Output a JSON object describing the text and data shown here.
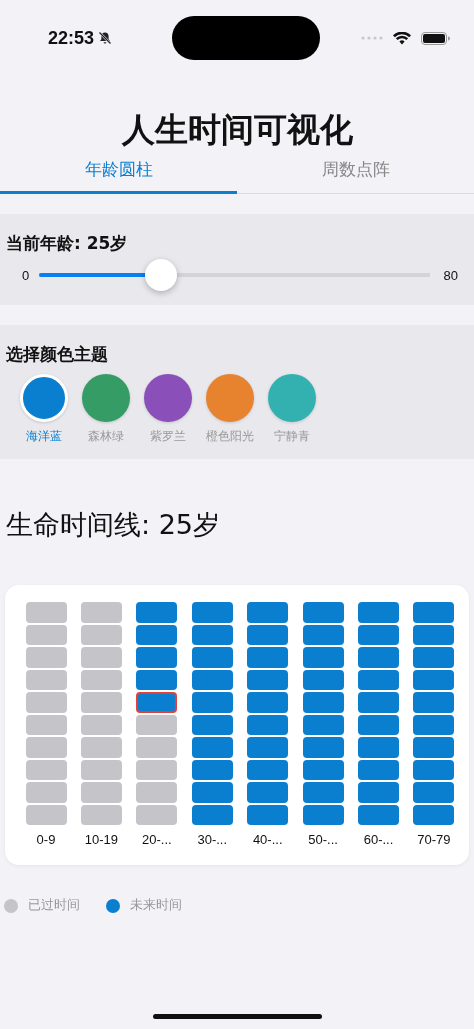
{
  "status_bar": {
    "time": "22:53"
  },
  "title": "人生时间可视化",
  "tabs": [
    {
      "label": "年龄圆柱",
      "selected": true
    },
    {
      "label": "周数点阵",
      "selected": false
    }
  ],
  "age_panel": {
    "label": "当前年龄: 25岁",
    "min_label": "0",
    "max_label": "80",
    "level": 0.3125
  },
  "theme_panel": {
    "title": "选择颜色主题",
    "themes": [
      {
        "label": "海洋蓝",
        "color": "#0a7fcf",
        "selected": true
      },
      {
        "label": "森林绿",
        "color": "#369c66",
        "selected": false
      },
      {
        "label": "紫罗兰",
        "color": "#8a4fb8",
        "selected": false
      },
      {
        "label": "橙色阳光",
        "color": "#e7832f",
        "selected": false
      },
      {
        "label": "宁静青",
        "color": "#33b1b1",
        "selected": false
      }
    ]
  },
  "timeline_heading": "生命时间线: 25岁",
  "columns": [
    {
      "label": "0-9",
      "cells": [
        {
          "passed": true,
          "current": false
        },
        {
          "passed": true,
          "current": false
        },
        {
          "passed": true,
          "current": false
        },
        {
          "passed": true,
          "current": false
        },
        {
          "passed": true,
          "current": false
        },
        {
          "passed": true,
          "current": false
        },
        {
          "passed": true,
          "current": false
        },
        {
          "passed": true,
          "current": false
        },
        {
          "passed": true,
          "current": false
        },
        {
          "passed": true,
          "current": false
        }
      ]
    },
    {
      "label": "10-19",
      "cells": [
        {
          "passed": true,
          "current": false
        },
        {
          "passed": true,
          "current": false
        },
        {
          "passed": true,
          "current": false
        },
        {
          "passed": true,
          "current": false
        },
        {
          "passed": true,
          "current": false
        },
        {
          "passed": true,
          "current": false
        },
        {
          "passed": true,
          "current": false
        },
        {
          "passed": true,
          "current": false
        },
        {
          "passed": true,
          "current": false
        },
        {
          "passed": true,
          "current": false
        }
      ]
    },
    {
      "label": "20-...",
      "cells": [
        {
          "passed": false,
          "current": false
        },
        {
          "passed": false,
          "current": false
        },
        {
          "passed": false,
          "current": false
        },
        {
          "passed": false,
          "current": false
        },
        {
          "passed": false,
          "current": true
        },
        {
          "passed": true,
          "current": false
        },
        {
          "passed": true,
          "current": false
        },
        {
          "passed": true,
          "current": false
        },
        {
          "passed": true,
          "current": false
        },
        {
          "passed": true,
          "current": false
        }
      ]
    },
    {
      "label": "30-...",
      "cells": [
        {
          "passed": false,
          "current": false
        },
        {
          "passed": false,
          "current": false
        },
        {
          "passed": false,
          "current": false
        },
        {
          "passed": false,
          "current": false
        },
        {
          "passed": false,
          "current": false
        },
        {
          "passed": false,
          "current": false
        },
        {
          "passed": false,
          "current": false
        },
        {
          "passed": false,
          "current": false
        },
        {
          "passed": false,
          "current": false
        },
        {
          "passed": false,
          "current": false
        }
      ]
    },
    {
      "label": "40-...",
      "cells": [
        {
          "passed": false,
          "current": false
        },
        {
          "passed": false,
          "current": false
        },
        {
          "passed": false,
          "current": false
        },
        {
          "passed": false,
          "current": false
        },
        {
          "passed": false,
          "current": false
        },
        {
          "passed": false,
          "current": false
        },
        {
          "passed": false,
          "current": false
        },
        {
          "passed": false,
          "current": false
        },
        {
          "passed": false,
          "current": false
        },
        {
          "passed": false,
          "current": false
        }
      ]
    },
    {
      "label": "50-...",
      "cells": [
        {
          "passed": false,
          "current": false
        },
        {
          "passed": false,
          "current": false
        },
        {
          "passed": false,
          "current": false
        },
        {
          "passed": false,
          "current": false
        },
        {
          "passed": false,
          "current": false
        },
        {
          "passed": false,
          "current": false
        },
        {
          "passed": false,
          "current": false
        },
        {
          "passed": false,
          "current": false
        },
        {
          "passed": false,
          "current": false
        },
        {
          "passed": false,
          "current": false
        }
      ]
    },
    {
      "label": "60-...",
      "cells": [
        {
          "passed": false,
          "current": false
        },
        {
          "passed": false,
          "current": false
        },
        {
          "passed": false,
          "current": false
        },
        {
          "passed": false,
          "current": false
        },
        {
          "passed": false,
          "current": false
        },
        {
          "passed": false,
          "current": false
        },
        {
          "passed": false,
          "current": false
        },
        {
          "passed": false,
          "current": false
        },
        {
          "passed": false,
          "current": false
        },
        {
          "passed": false,
          "current": false
        }
      ]
    },
    {
      "label": "70-79",
      "cells": [
        {
          "passed": false,
          "current": false
        },
        {
          "passed": false,
          "current": false
        },
        {
          "passed": false,
          "current": false
        },
        {
          "passed": false,
          "current": false
        },
        {
          "passed": false,
          "current": false
        },
        {
          "passed": false,
          "current": false
        },
        {
          "passed": false,
          "current": false
        },
        {
          "passed": false,
          "current": false
        },
        {
          "passed": false,
          "current": false
        },
        {
          "passed": false,
          "current": false
        }
      ]
    }
  ],
  "legend": [
    {
      "label": "已过时间",
      "color": "#c4c4c9"
    },
    {
      "label": "未来时间",
      "color": "#0a7fcf"
    }
  ]
}
